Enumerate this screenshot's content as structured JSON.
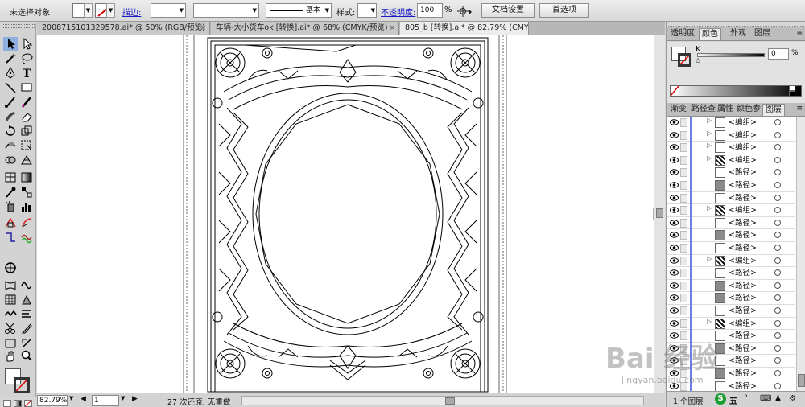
{
  "control_bar": {
    "selection_label": "未选择对象",
    "stroke_link": "描边:",
    "stroke_profile": "基本",
    "style_label": "样式:",
    "opacity_link": "不透明度:",
    "opacity_value": "100",
    "opacity_unit": "%",
    "doc_setup_button": "文档设置",
    "prefs_button": "首选项"
  },
  "tabs": [
    {
      "label": "2008715101329578.ai* @ 50% (RGB/预览)"
    },
    {
      "label": "车辆-大小货车ok [转换].ai* @ 68% (CMYK/预览)"
    },
    {
      "label": "805_b [转换].ai* @ 82.79% (CMYK/轮廓)"
    }
  ],
  "close_glyph": "×",
  "color_panel": {
    "tabs": [
      "透明度",
      "颜色",
      "外观",
      "图层"
    ],
    "active_tab": 1,
    "k_label": "K",
    "k_value": "0",
    "k_unit": "%"
  },
  "layers_panel": {
    "tabs": [
      "渐变",
      "路径查",
      "属性",
      "颜色参",
      "图层"
    ],
    "active_tab": 4,
    "rows": [
      {
        "name": "<编组>",
        "arrow": "▷",
        "thumb": "white"
      },
      {
        "name": "<编组>",
        "arrow": "▷",
        "thumb": "white"
      },
      {
        "name": "<编组>",
        "arrow": "▷",
        "thumb": "white"
      },
      {
        "name": "<编组>",
        "arrow": "▷",
        "thumb": "pattern"
      },
      {
        "name": "<路径>",
        "arrow": "",
        "thumb": "white"
      },
      {
        "name": "<路径>",
        "arrow": "",
        "thumb": "gray"
      },
      {
        "name": "<路径>",
        "arrow": "",
        "thumb": "white"
      },
      {
        "name": "<编组>",
        "arrow": "▷",
        "thumb": "pattern"
      },
      {
        "name": "<路径>",
        "arrow": "",
        "thumb": "white"
      },
      {
        "name": "<路径>",
        "arrow": "",
        "thumb": "gray"
      },
      {
        "name": "<路径>",
        "arrow": "",
        "thumb": "white"
      },
      {
        "name": "<编组>",
        "arrow": "▷",
        "thumb": "pattern"
      },
      {
        "name": "<路径>",
        "arrow": "",
        "thumb": "white"
      },
      {
        "name": "<路径>",
        "arrow": "",
        "thumb": "gray"
      },
      {
        "name": "<路径>",
        "arrow": "",
        "thumb": "gray"
      },
      {
        "name": "<路径>",
        "arrow": "",
        "thumb": "white"
      },
      {
        "name": "<编组>",
        "arrow": "▷",
        "thumb": "pattern"
      },
      {
        "name": "<路径>",
        "arrow": "",
        "thumb": "white"
      },
      {
        "name": "<路径>",
        "arrow": "",
        "thumb": "gray"
      },
      {
        "name": "<路径>",
        "arrow": "",
        "thumb": "white"
      },
      {
        "name": "<路径>",
        "arrow": "",
        "thumb": "gray"
      },
      {
        "name": "<路径>",
        "arrow": "",
        "thumb": "white"
      }
    ],
    "footer_label": "1 个图层"
  },
  "status_bar": {
    "zoom": "82.79%",
    "artboard": "1",
    "history": "27 次还原; 无重做"
  },
  "watermark": {
    "text": "Bai 经验",
    "url": "jingyan.baidu.com"
  },
  "ime": {
    "logo": "S",
    "label": "五"
  },
  "colors": {
    "accent_layer_bar": "#6b7ee8",
    "link_blue": "#1a1ac8"
  }
}
